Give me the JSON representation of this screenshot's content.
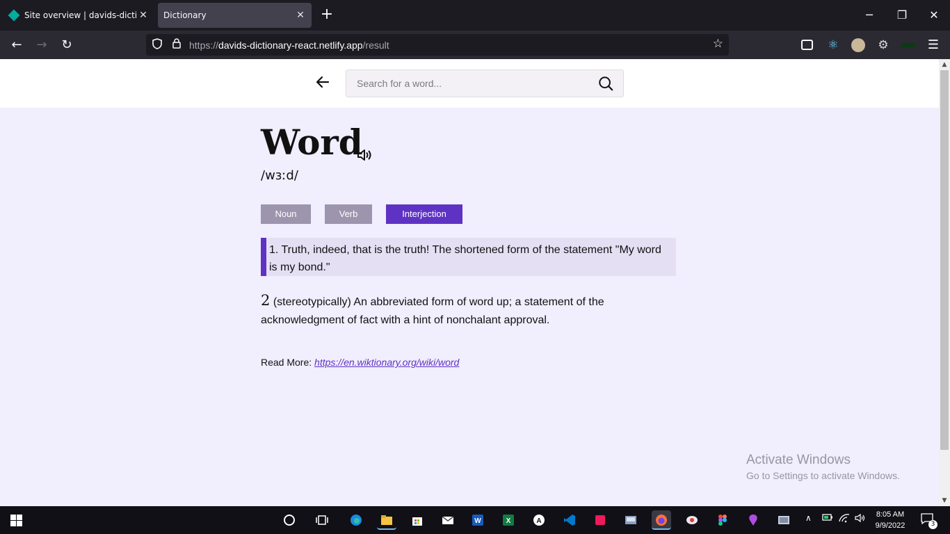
{
  "browser": {
    "tabs": [
      {
        "title": "Site overview | davids-dictionary",
        "active": false
      },
      {
        "title": "Dictionary",
        "active": true
      }
    ],
    "new_tab_label": "+",
    "url": {
      "prefix": "https://",
      "host": "davids-dictionary-react.netlify.app",
      "path": "/result"
    },
    "window_controls": {
      "minimize": "─",
      "restore": "❐",
      "close": "✕"
    }
  },
  "page": {
    "search_placeholder": "Search for a word...",
    "word": "Word",
    "phonetic": "/wɜːd/",
    "parts_of_speech": [
      "Noun",
      "Verb",
      "Interjection"
    ],
    "selected_part_of_speech": "Interjection",
    "definitions": [
      {
        "number": "1.",
        "text": "Truth, indeed, that is the truth! The shortened form of the statement \"My word is my bond.\""
      },
      {
        "number": "2",
        "text": "(stereotypically) An abbreviated form of word up; a statement of the acknowledgment of fact with a hint of nonchalant approval."
      }
    ],
    "read_more_label": "Read More:",
    "read_more_link": "https://en.wiktionary.org/wiki/word"
  },
  "watermark": {
    "title": "Activate Windows",
    "subtitle": "Go to Settings to activate Windows."
  },
  "taskbar": {
    "apps": [
      "cortana-icon",
      "task-view-icon",
      "edge-icon",
      "file-explorer-icon",
      "store-icon",
      "mail-icon",
      "word-icon",
      "excel-icon",
      "app-icon",
      "vscode-icon",
      "app2-icon",
      "app3-icon",
      "firefox-icon",
      "app4-icon",
      "figma-icon",
      "app5-icon",
      "app6-icon"
    ],
    "time": "8:05 AM",
    "date": "9/9/2022",
    "notifications_count": "3"
  },
  "colors": {
    "accent": "#5e33c4",
    "inactive_button": "#9c95ad",
    "page_background": "#f1eefd",
    "definition_highlight": "#e5dff4"
  }
}
